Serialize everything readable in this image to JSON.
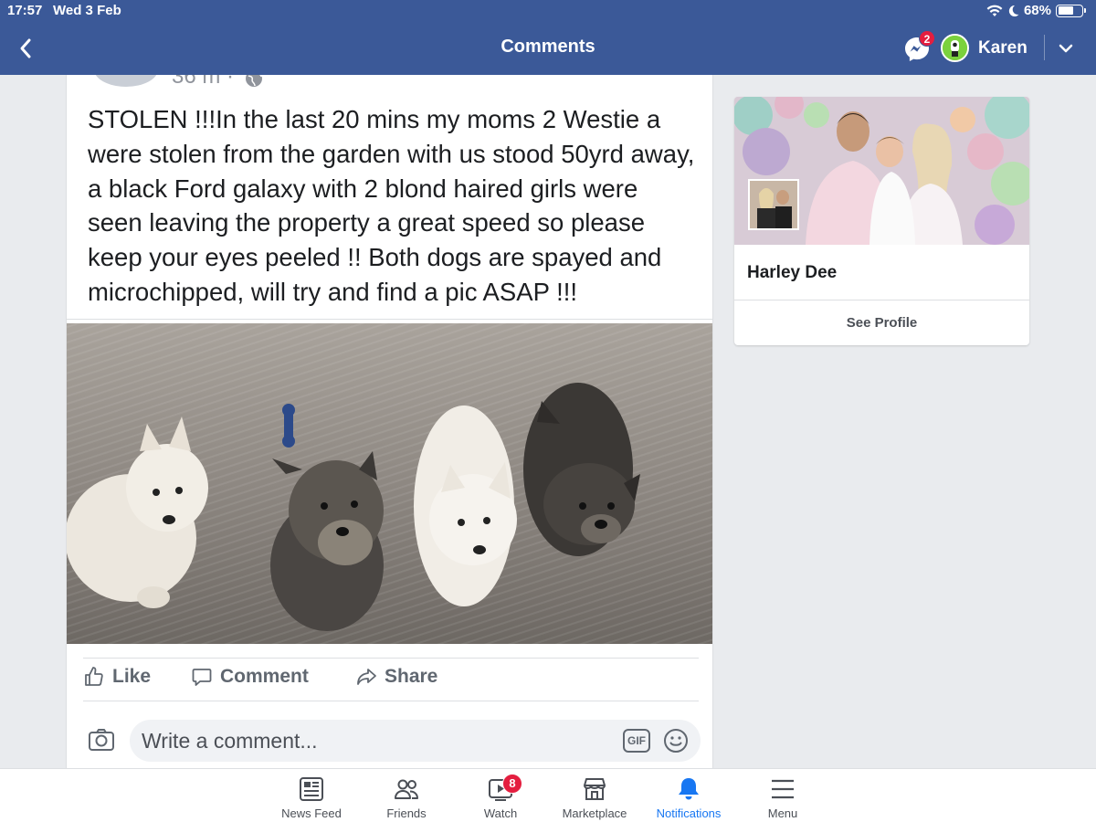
{
  "status_bar": {
    "time": "17:57",
    "date": "Wed 3 Feb",
    "battery": "68%",
    "battery_level": 0.68
  },
  "nav": {
    "title": "Comments",
    "messenger_badge": "2",
    "profile_name": "Karen",
    "icons": [
      "back-chevron-icon",
      "messenger-icon",
      "avatar",
      "chevron-down-icon"
    ]
  },
  "post": {
    "time_partial": "36 m ·",
    "text": "STOLEN !!!In the last 20 mins my moms 2 Westie a were stolen from the garden with us stood 50yrd away, a black Ford galaxy with 2 blond haired girls were seen leaving the property a great speed so please keep your eyes peeled !! Both dogs are spayed and microchipped, will try and find a pic ASAP !!!",
    "actions": {
      "like": "Like",
      "comment": "Comment",
      "share": "Share"
    },
    "comment_placeholder": "Write a comment...",
    "gif_label": "GIF"
  },
  "profile_card": {
    "name": "Harley Dee",
    "button": "See Profile"
  },
  "tabbar": {
    "items": [
      {
        "label": "News Feed",
        "icon": "news-feed-icon"
      },
      {
        "label": "Friends",
        "icon": "friends-icon"
      },
      {
        "label": "Watch",
        "icon": "watch-icon",
        "badge": "8"
      },
      {
        "label": "Marketplace",
        "icon": "marketplace-icon"
      },
      {
        "label": "Notifications",
        "icon": "bell-icon",
        "active": true
      },
      {
        "label": "Menu",
        "icon": "menu-icon"
      }
    ]
  },
  "colors": {
    "brand": "#3b5998",
    "active_tab": "#1877f2",
    "badge": "#e41e3f",
    "background": "#e9ebee"
  }
}
